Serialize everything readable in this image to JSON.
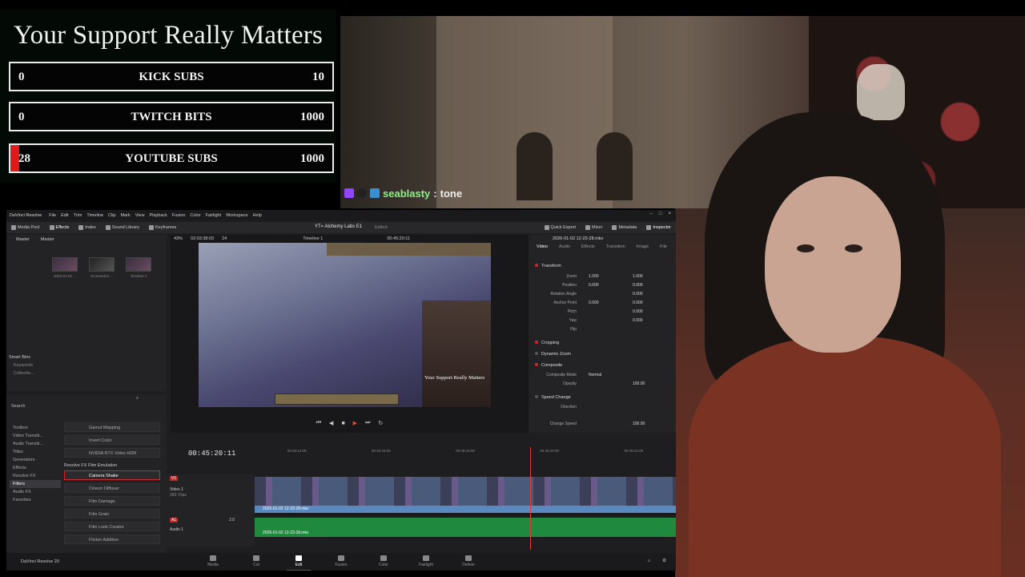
{
  "goals": {
    "title": "Your Support Really Matters",
    "bars": [
      {
        "current": "0",
        "label": "KICK SUBS",
        "max": "10",
        "progress": 0.0
      },
      {
        "current": "0",
        "label": "TWITCH BITS",
        "max": "1000",
        "progress": 0.0
      },
      {
        "current": "28",
        "label": "YOUTUBE SUBS",
        "max": "1000",
        "progress": 0.028
      }
    ]
  },
  "chat": {
    "user": "seablasty",
    "separator": ":",
    "message": "tone"
  },
  "resolve": {
    "app_name": "DaVinci Resolve",
    "menus": [
      "File",
      "Edit",
      "Trim",
      "Timeline",
      "Clip",
      "Mark",
      "View",
      "Playback",
      "Fusion",
      "Color",
      "Fairlight",
      "Workspace",
      "Help"
    ],
    "toolbar_left": [
      "Media Pool",
      "Effects",
      "Index",
      "Sound Library",
      "Keyframes"
    ],
    "project_title": "YT= Alchemy Labs E1",
    "edited": "Edited",
    "toolbar_right": [
      "Quick Export",
      "Mixer",
      "Metadata",
      "Inspector"
    ],
    "mediapool": {
      "tabs": [
        "Master",
        "Master"
      ],
      "clips": [
        "2026-01-02 ...",
        "Screenshot ...",
        "Timeline 1"
      ],
      "smart_bins": "Smart Bins",
      "bins": [
        "Keywords",
        "Collectio..."
      ]
    },
    "fx": {
      "search": "Search",
      "tree": [
        "Toolbox",
        "Video Transiti...",
        "Audio Transiti...",
        "Titles",
        "Generators",
        "Effects",
        "Resolve FX",
        "Filters",
        "Audio FX",
        "Favorites"
      ],
      "items_top": [
        "Gamut Mapping",
        "Invert Color",
        "NVIDIA RTX Video HDR"
      ],
      "group": "Resolve FX Film Emulation",
      "items": [
        "Camera Shake",
        "Cineon Diffuser",
        "Film Damage",
        "Film Grain",
        "Film Look Creator",
        "Flicker Addition"
      ]
    },
    "viewer": {
      "zoom": "43%",
      "source_tc": "02:03:38:03",
      "fps": "24",
      "timeline_name": "Timeline 1",
      "record_tc": "00:45:20:11",
      "overlay_text": "Your Support Really Matters"
    },
    "inspector": {
      "clip_name": "2026-01-02 12-23-28.mkv",
      "tabs": [
        "Video",
        "Audio",
        "Effects",
        "Transition",
        "Image",
        "File"
      ],
      "transform": "Transform",
      "rows": [
        {
          "k": "Zoom",
          "x": "1.000",
          "y": "1.000"
        },
        {
          "k": "Position",
          "x": "0.000",
          "y": "0.000"
        },
        {
          "k": "Rotation Angle",
          "x": "",
          "y": "0.000"
        },
        {
          "k": "Anchor Point",
          "x": "0.000",
          "y": "0.000"
        },
        {
          "k": "Pitch",
          "x": "",
          "y": "0.000"
        },
        {
          "k": "Yaw",
          "x": "",
          "y": "0.000"
        },
        {
          "k": "Flip",
          "x": "",
          "y": ""
        }
      ],
      "cropping": "Cropping",
      "dynamic_zoom": "Dynamic Zoom",
      "composite": "Composite",
      "composite_mode_label": "Composite Mode",
      "composite_mode": "Normal",
      "opacity_label": "Opacity",
      "opacity": "100.00",
      "speed_change": "Speed Change",
      "direction": "Direction",
      "change_speed_label": "Change Speed",
      "change_speed": "100.00"
    },
    "timeline": {
      "timecode": "00:45:20:11",
      "ruler": [
        "00:45:14:00",
        "00:45:16:00",
        "00:45:18:00",
        "00:45:20:00",
        "00:45:22:00"
      ],
      "video_track": "Video 1",
      "video_track_tag": "V1",
      "video_clips_count": "283 Clips",
      "audio_track": "Audio 1",
      "audio_track_tag": "A1",
      "audio_level": "2.0",
      "clip_label": "2026-01-02 12-23-28.mkv"
    },
    "pages": [
      "Media",
      "Cut",
      "Edit",
      "Fusion",
      "Color",
      "Fairlight",
      "Deliver"
    ],
    "active_page": "Edit",
    "brand": "DaVinci Resolve 20"
  },
  "colors": {
    "accent_red": "#e01a1a",
    "chat_user": "#8ff08a",
    "audio_green": "#1f8a3e",
    "video_label_blue": "#5a89c0"
  }
}
